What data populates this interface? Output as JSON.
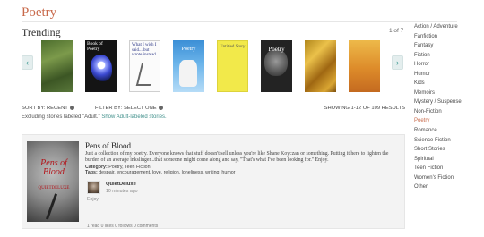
{
  "header": {
    "title": "Poetry"
  },
  "trending": {
    "title": "Trending",
    "pager": "1 of 7",
    "prev_glyph": "‹",
    "next_glyph": "›",
    "covers": [
      {
        "text": ""
      },
      {
        "text": "Book of Poetry"
      },
      {
        "text": "What I wish I said... but wrote instead"
      },
      {
        "text": "Poetry"
      },
      {
        "text": "Untitled Story"
      },
      {
        "text": "Poetry"
      },
      {
        "text": ""
      },
      {
        "text": ""
      }
    ]
  },
  "sidebar": {
    "items": [
      {
        "label": "Action / Adventure"
      },
      {
        "label": "Fanfiction"
      },
      {
        "label": "Fantasy"
      },
      {
        "label": "Fiction"
      },
      {
        "label": "Horror"
      },
      {
        "label": "Humor"
      },
      {
        "label": "Kids"
      },
      {
        "label": "Memoirs"
      },
      {
        "label": "Mystery / Suspense"
      },
      {
        "label": "Non-Fiction"
      },
      {
        "label": "Poetry"
      },
      {
        "label": "Romance"
      },
      {
        "label": "Science Fiction"
      },
      {
        "label": "Short Stories"
      },
      {
        "label": "Spiritual"
      },
      {
        "label": "Teen Fiction"
      },
      {
        "label": "Women's Fiction"
      },
      {
        "label": "Other"
      }
    ],
    "active": "Poetry"
  },
  "controls": {
    "sort_label": "SORT BY:",
    "sort_value": "RECENT",
    "filter_label": "FILTER BY:",
    "filter_value": "SELECT ONE",
    "results": "SHOWING 1-12 OF 109 RESULTS",
    "exclusion_text": "Excluding stories labeled \"Adult.\"",
    "exclusion_link": "Show Adult-labeled stories."
  },
  "story": {
    "cover_title": "Pens of Blood",
    "cover_author": "QUIETDELUXE",
    "title": "Pens of Blood",
    "description": "Just a collection of my poetry. Everyone knows that stuff doesn't sell unless you're like Shane Koyczan or something. Putting it here to lighten the burden of an average inkslinger...that someone might come along and say, \"That's what I've been looking for.\" Enjoy.",
    "category_label": "Category:",
    "category_value": "Poetry, Teen Fiction",
    "tags_label": "Tags:",
    "tags_value": "despair, encouragement, love, religion, loneliness, writing, humor",
    "author_name": "QuietDeluxe",
    "author_time": "10 minutes ago",
    "category_short": "Enjoy",
    "stats": "1 read   0 likes   0 follows   0 comments"
  },
  "colors": {
    "accent": "#c8694a",
    "teal": "#3f9a93"
  }
}
